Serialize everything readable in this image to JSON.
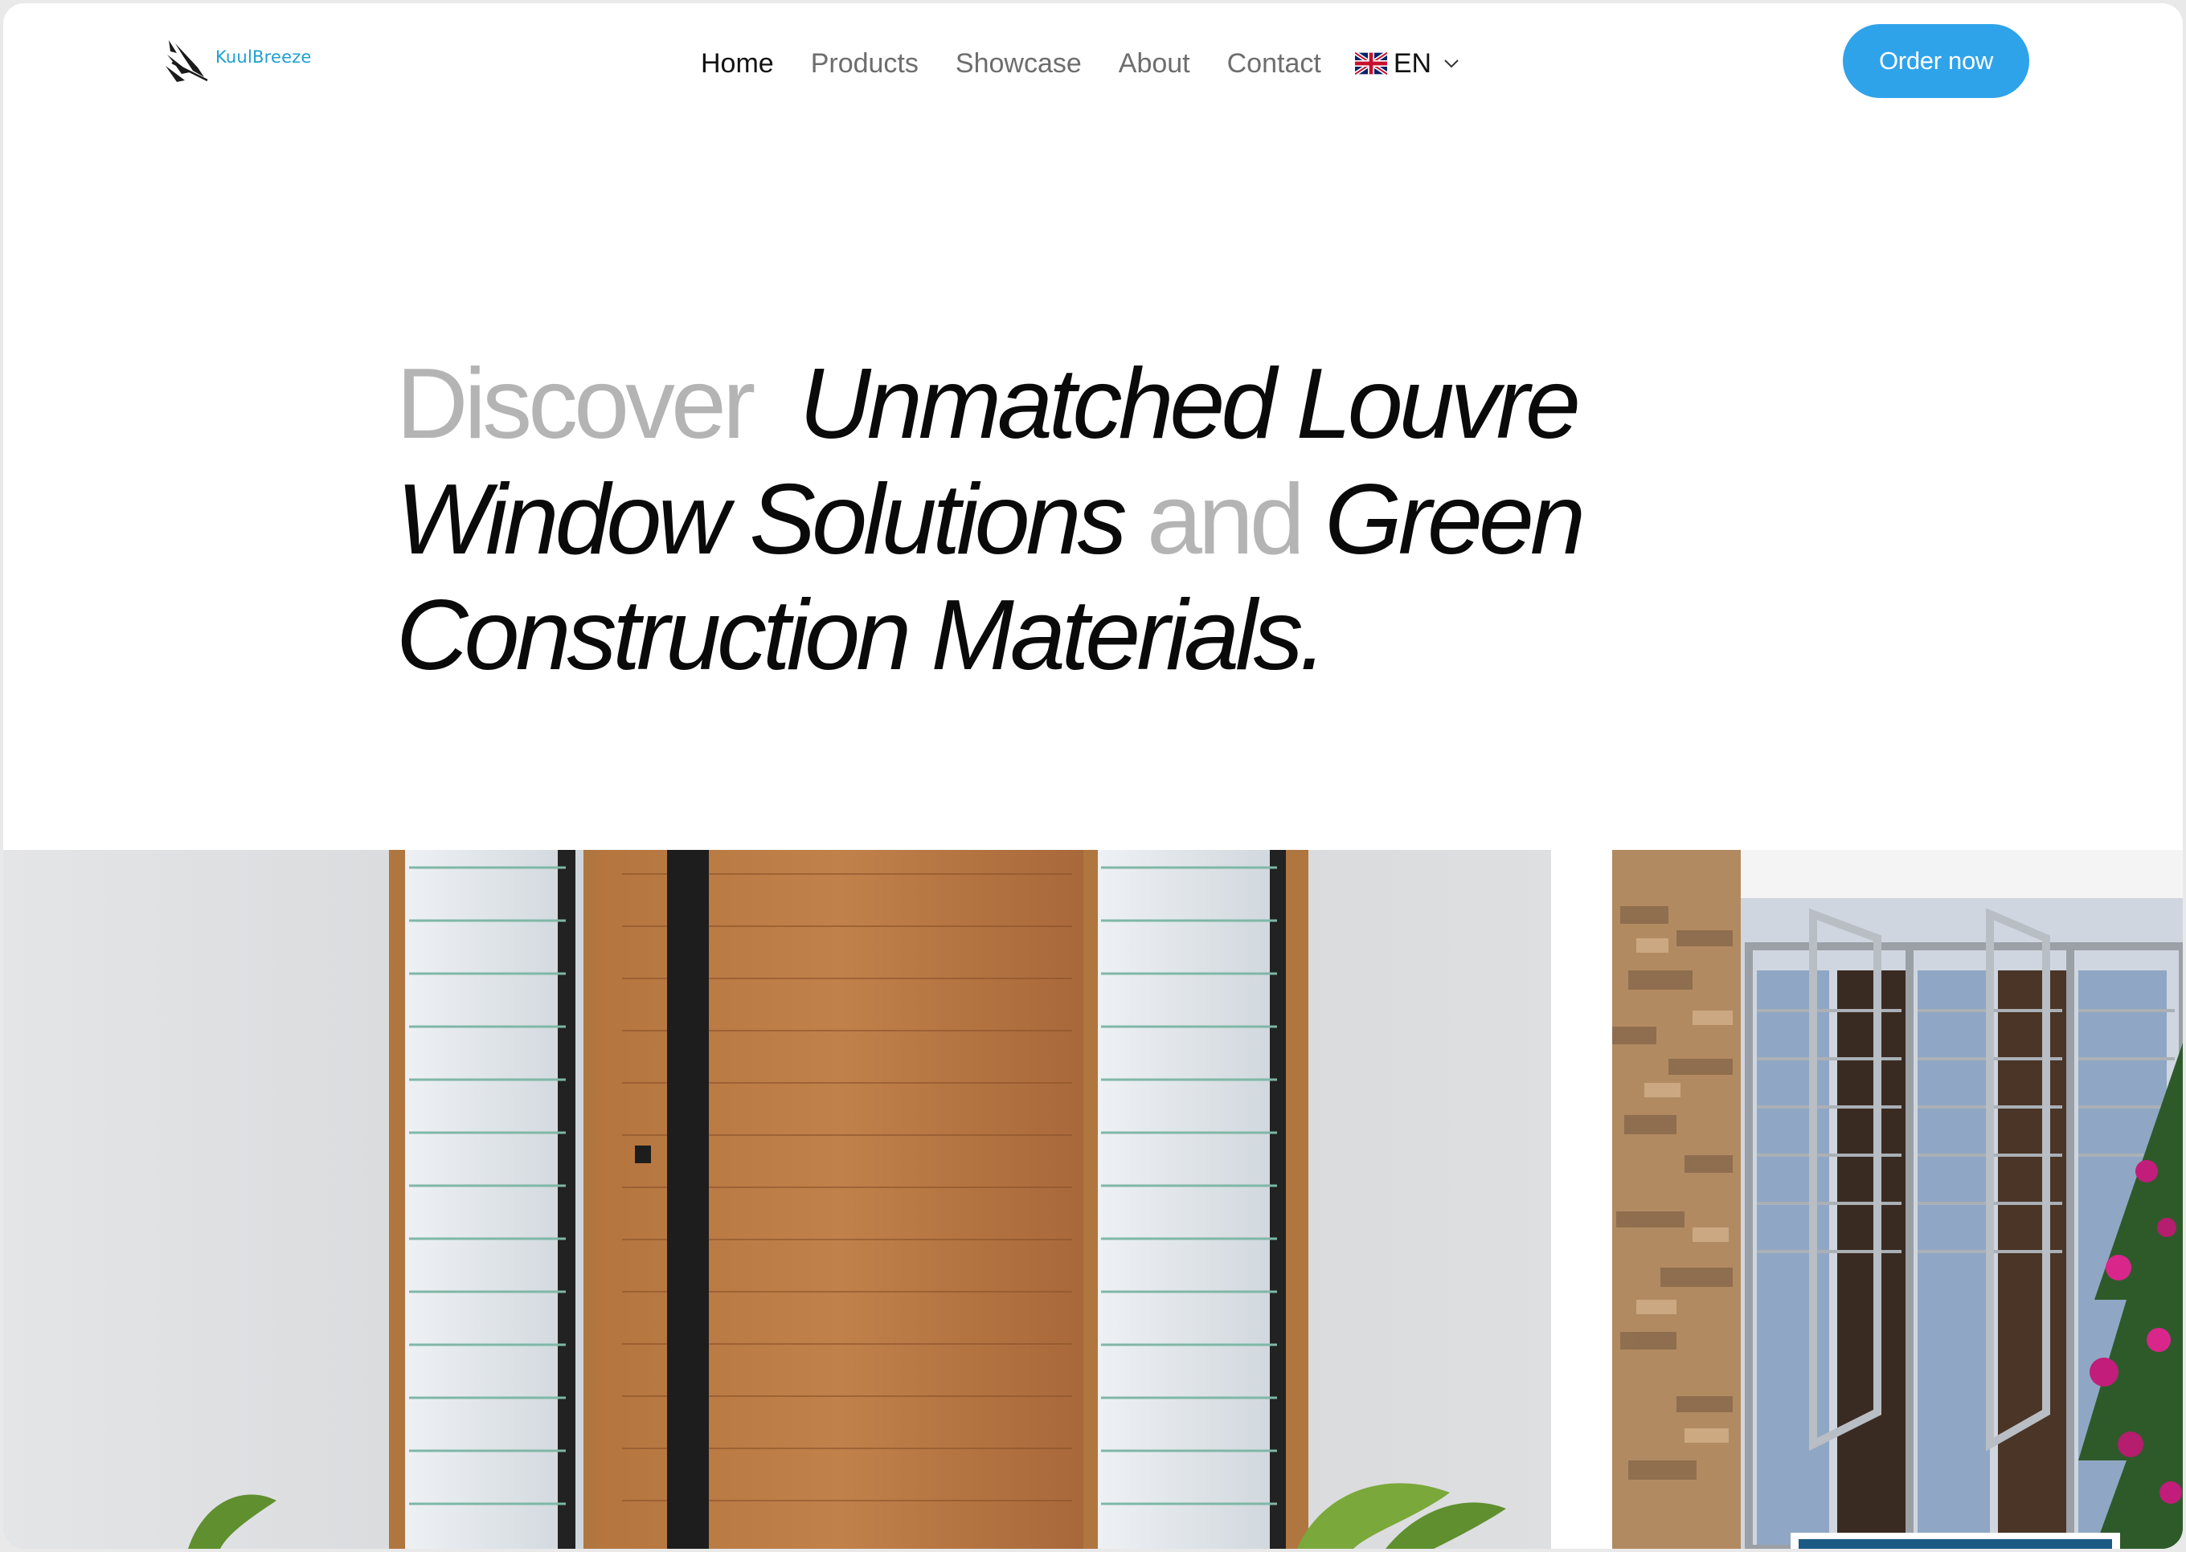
{
  "brand": {
    "name": "KuulBreeze"
  },
  "nav": {
    "items": [
      {
        "label": "Home",
        "active": true
      },
      {
        "label": "Products",
        "active": false
      },
      {
        "label": "Showcase",
        "active": false
      },
      {
        "label": "About",
        "active": false
      },
      {
        "label": "Contact",
        "active": false
      }
    ],
    "language": {
      "code": "EN",
      "flag_icon": "uk-flag-icon"
    },
    "cta_label": "Order now"
  },
  "hero": {
    "part1": "Discover",
    "part2": "Unmatched Louvre Window Solutions",
    "part3": "and",
    "part4": "Green Construction Materials."
  },
  "gallery": [
    {
      "name": "louvre-door-photo"
    },
    {
      "name": "bifold-windows-photo"
    }
  ],
  "colors": {
    "accent": "#2EA3EA",
    "brand_text": "#1E9FD0",
    "heading": "#0D0D0D",
    "heading_muted": "#B4B4B4",
    "nav_text": "#6D6D6D"
  }
}
